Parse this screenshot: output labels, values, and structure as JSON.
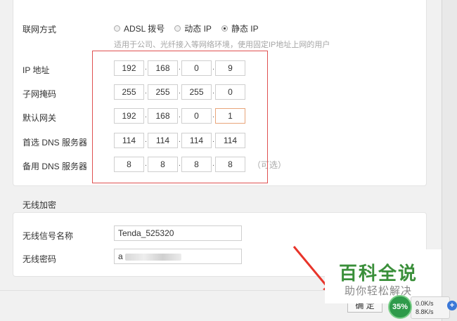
{
  "connection": {
    "label": "联网方式",
    "options": [
      {
        "label": "ADSL 拨号",
        "selected": false
      },
      {
        "label": "动态 IP",
        "selected": false
      },
      {
        "label": "静态 IP",
        "selected": true
      }
    ],
    "hint": "适用于公司、光纤接入等网络环境，使用固定IP地址上网的用户"
  },
  "fields": [
    {
      "label": "IP 地址",
      "octets": [
        "192",
        "168",
        "0",
        "9"
      ]
    },
    {
      "label": "子网掩码",
      "octets": [
        "255",
        "255",
        "255",
        "0"
      ]
    },
    {
      "label": "默认网关",
      "octets": [
        "192",
        "168",
        "0",
        "1"
      ]
    },
    {
      "label": "首选 DNS 服务器",
      "octets": [
        "114",
        "114",
        "114",
        "114"
      ]
    },
    {
      "label": "备用 DNS 服务器",
      "octets": [
        "8",
        "8",
        "8",
        "8"
      ],
      "suffix": "（可选）"
    }
  ],
  "wireless": {
    "title": "无线加密",
    "ssid_label": "无线信号名称",
    "ssid_value": "Tenda_525320",
    "password_label": "无线密码",
    "password_value": "a"
  },
  "footer": {
    "ok_label": "确 定"
  },
  "watermark": {
    "title": "百科全说",
    "subtitle": "助你轻松解决"
  },
  "net_widget": {
    "percent": "35%",
    "up": "0.0K/s",
    "down": "8.8K/s",
    "add_symbol": "+"
  },
  "colors": {
    "highlight_box": "#e05050",
    "watermark_green": "#3a8f3a",
    "badge_green": "#2e9a4a"
  }
}
